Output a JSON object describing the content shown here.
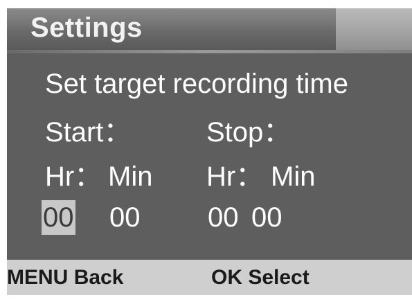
{
  "title": "Settings",
  "heading": "Set target recording time",
  "start_label": "Start：",
  "stop_label": "Stop：",
  "hr_label": "Hr：",
  "min_label": "Min",
  "start": {
    "hr": "00",
    "min": "00"
  },
  "stop": {
    "hr": "00",
    "min": "00"
  },
  "selected_field": "start.hr",
  "footer": {
    "menu_key": "MENU",
    "menu_action": "Back",
    "ok_key": "OK",
    "ok_action": "Select"
  },
  "colors": {
    "screen_bg": "#5e5e5e",
    "text": "#ffffff",
    "selection_bg": "#c8c8c8",
    "footer_bg": "#cfcfcf"
  }
}
